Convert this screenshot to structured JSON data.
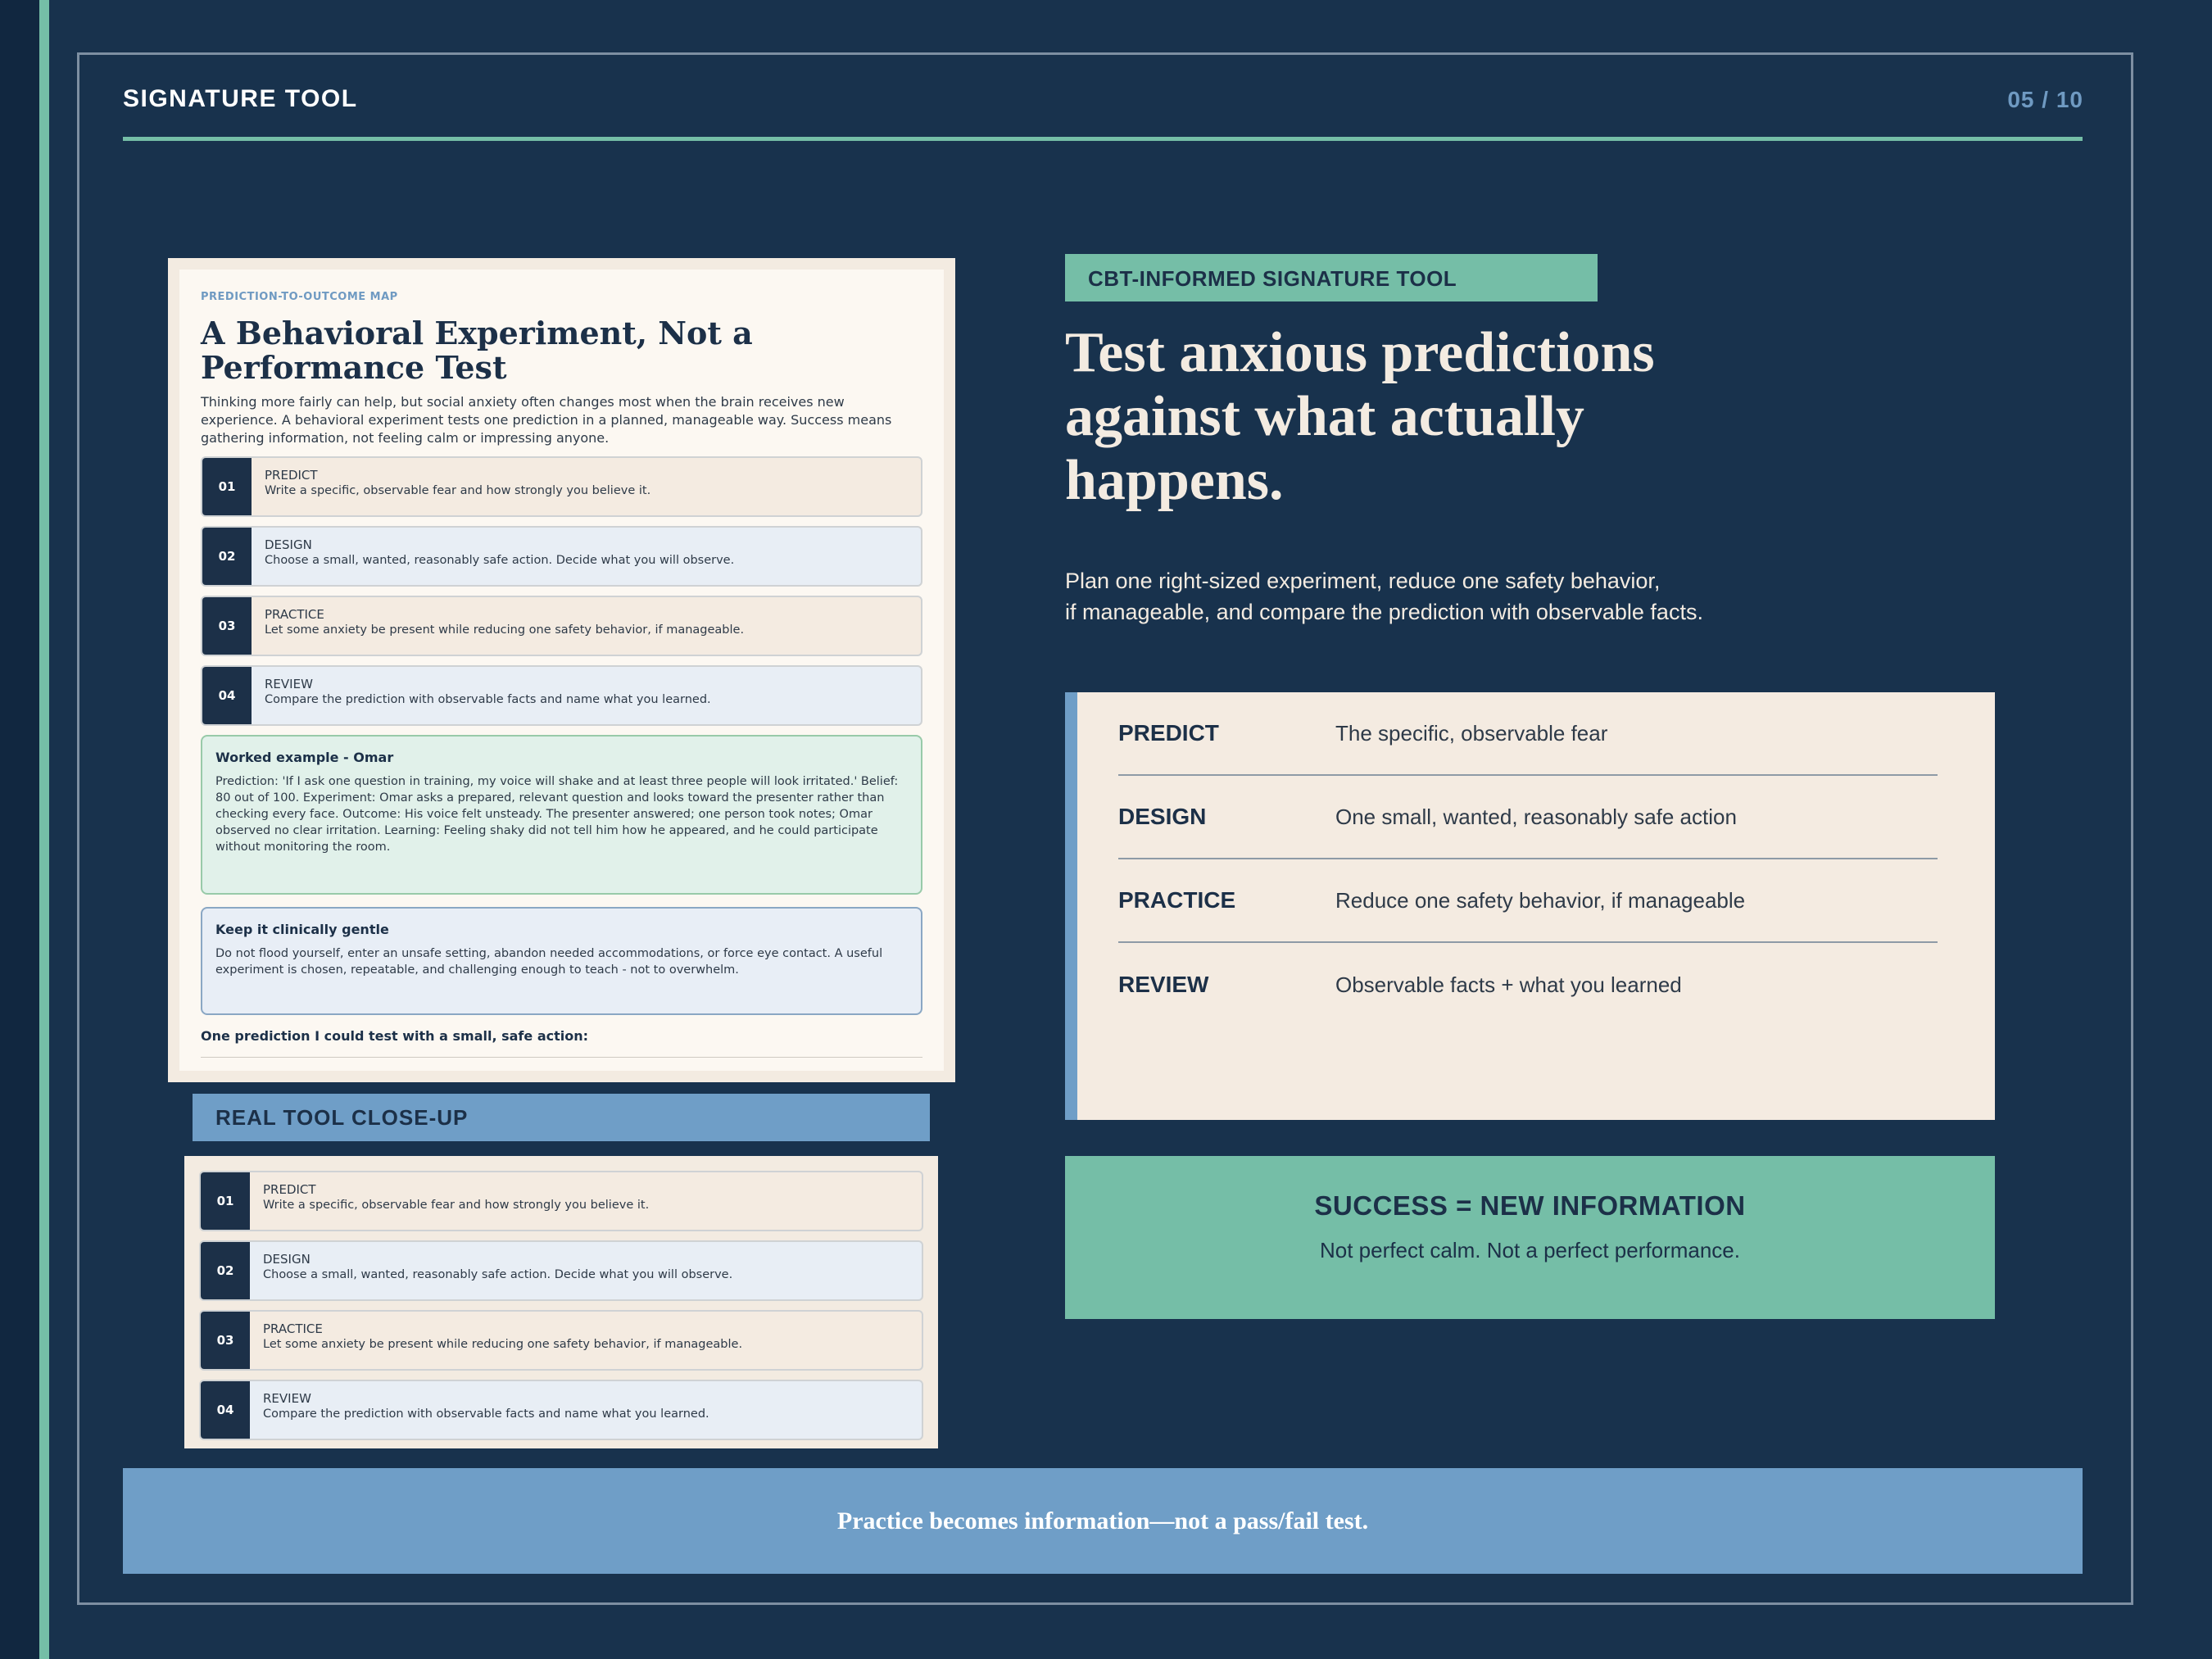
{
  "header": {
    "title": "SIGNATURE TOOL",
    "page": "05 / 10"
  },
  "document": {
    "kicker": "PREDICTION-TO-OUTCOME MAP",
    "title": "A Behavioral Experiment, Not a Performance Test",
    "intro": "Thinking more fairly can help, but social anxiety often changes most when the brain receives new experience. A behavioral experiment tests one prediction in a planned, manageable way. Success means gathering information, not feeling calm or impressing anyone.",
    "steps": [
      {
        "num": "01",
        "label": "PREDICT",
        "text": "Write a specific, observable fear and how strongly you believe it."
      },
      {
        "num": "02",
        "label": "DESIGN",
        "text": "Choose a small, wanted, reasonably safe action. Decide what you will observe."
      },
      {
        "num": "03",
        "label": "PRACTICE",
        "text": "Let some anxiety be present while reducing one safety behavior, if manageable."
      },
      {
        "num": "04",
        "label": "REVIEW",
        "text": "Compare the prediction with observable facts and name what you learned."
      }
    ],
    "example": {
      "title": "Worked example - Omar",
      "text": "Prediction: 'If I ask one question in training, my voice will shake and at least three people will look irritated.' Belief: 80 out of 100. Experiment: Omar asks a prepared, relevant question and looks toward the presenter rather than checking every face. Outcome: His voice felt unsteady. The presenter answered; one person took notes; Omar observed no clear irritation. Learning: Feeling shaky did not tell him how he appeared, and he could participate without monitoring the room."
    },
    "gentle": {
      "title": "Keep it clinically gentle",
      "text": "Do not flood yourself, enter an unsafe setting, abandon needed accommodations, or force eye contact. A useful experiment is chosen, repeatable, and challenging enough to teach - not to overwhelm."
    },
    "prompt": "One prediction I could test with a small, safe action:"
  },
  "closeup": {
    "label": "REAL TOOL CLOSE-UP"
  },
  "right": {
    "tag": "CBT-INFORMED SIGNATURE TOOL",
    "headline": "Test anxious predictions against what actually happens.",
    "sub_line1": "Plan one right-sized experiment, reduce one safety behavior,",
    "sub_line2": "if manageable, and compare the prediction with observable facts.",
    "panel": [
      {
        "key": "PREDICT",
        "value": "The specific, observable fear"
      },
      {
        "key": "DESIGN",
        "value": "One small, wanted, reasonably safe action"
      },
      {
        "key": "PRACTICE",
        "value": "Reduce one safety behavior, if manageable"
      },
      {
        "key": "REVIEW",
        "value": "Observable facts + what you learned"
      }
    ],
    "success_title": "SUCCESS = NEW INFORMATION",
    "success_sub": "Not perfect calm. Not a perfect performance."
  },
  "footer": {
    "text": "Practice becomes information—not a pass/fail test."
  }
}
